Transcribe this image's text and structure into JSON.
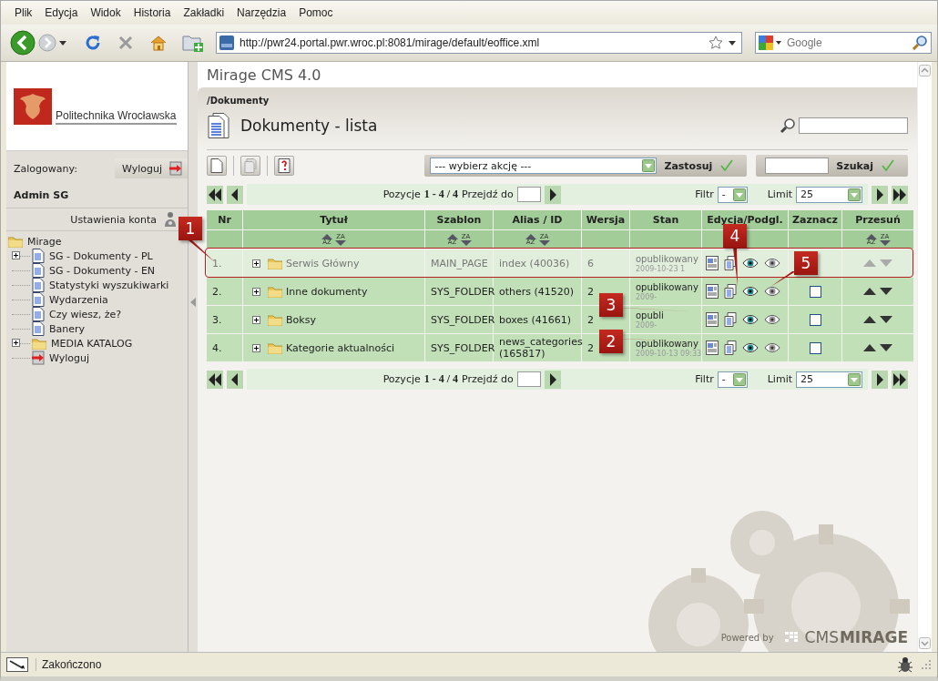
{
  "menu": [
    {
      "label": "Plik"
    },
    {
      "label": "Edycja"
    },
    {
      "label": "Widok"
    },
    {
      "label": "Historia"
    },
    {
      "label": "Zakładki"
    },
    {
      "label": "Narzędzia"
    },
    {
      "label": "Pomoc"
    }
  ],
  "nav": {
    "url": "http://pwr24.portal.pwr.wroc.pl:8081/mirage/default/eoffice.xml",
    "search_placeholder": "Google"
  },
  "app_title": "Mirage CMS 4.0",
  "sidebar": {
    "logo_text": "Politechnika Wrocławska",
    "logged_label": "Zalogowany:",
    "logout_button": "Wyloguj",
    "user": "Admin SG",
    "settings_link": "Ustawienia konta",
    "tree": [
      {
        "label": "Mirage",
        "kind": "folder",
        "expanded": true,
        "children": [
          {
            "label": "SG - Dokumenty - PL",
            "kind": "document",
            "expanded": false
          },
          {
            "label": "SG - Dokumenty - EN",
            "kind": "document"
          },
          {
            "label": "Statystyki wyszukiwarki",
            "kind": "document"
          },
          {
            "label": "Wydarzenia",
            "kind": "document"
          },
          {
            "label": "Czy wiesz, że?",
            "kind": "document"
          },
          {
            "label": "Banery",
            "kind": "document"
          },
          {
            "label": "MEDIA KATALOG",
            "kind": "folder",
            "expanded": false
          },
          {
            "label": "Wyloguj",
            "kind": "logout"
          }
        ]
      }
    ]
  },
  "breadcrumb": "/Dokumenty",
  "page_title": "Dokumenty - lista",
  "toolbar": {
    "action_select": "--- wybierz akcję ---",
    "apply_button": "Zastosuj",
    "search_button": "Szukaj"
  },
  "pagers": [
    {
      "label": "Pozycje",
      "range": "1 - 4 / 4",
      "goto_label": "Przejdź do",
      "filter_label": "Filtr",
      "filter_value": "-",
      "limit_label": "Limit",
      "limit_value": "25"
    },
    {
      "label": "Pozycje",
      "range": "1 - 4 / 4",
      "goto_label": "Przejdź do",
      "filter_label": "Filtr",
      "filter_value": "-",
      "limit_label": "Limit",
      "limit_value": "25"
    }
  ],
  "table": {
    "columns": [
      {
        "label": "Nr"
      },
      {
        "label": "Tytuł",
        "sort": [
          "AZ",
          "ZA"
        ]
      },
      {
        "label": "Szablon",
        "sort": [
          "AZ",
          "ZA"
        ]
      },
      {
        "label": "Alias / ID",
        "sort": [
          "AZ",
          "ZA"
        ]
      },
      {
        "label": "Wersja"
      },
      {
        "label": "Stan"
      },
      {
        "label": "Edycja/Podgl."
      },
      {
        "label": "Zaznacz"
      },
      {
        "label": "Przesuń",
        "sort": [
          "AZ",
          "ZA"
        ]
      }
    ],
    "rows": [
      {
        "nr": "1.",
        "title": "Serwis Główny",
        "expanded": false,
        "template": "MAIN_PAGE",
        "alias": "index (40036)",
        "version": "6",
        "status": "opublikowany",
        "date": "2009-10-23 1",
        "highlighted": true
      },
      {
        "nr": "2.",
        "title": "Inne dokumenty",
        "expanded": false,
        "template": "SYS_FOLDER",
        "alias": "others (41520)",
        "version": "2",
        "status": "opublikowany",
        "date": "2009-",
        "highlighted": false,
        "checked": false
      },
      {
        "nr": "3.",
        "title": "Boksy",
        "expanded": false,
        "template": "SYS_FOLDER",
        "alias": "boxes (41661)",
        "version": "2",
        "status": "opubli",
        "date": "2009-",
        "highlighted": false,
        "checked": false
      },
      {
        "nr": "4.",
        "title": "Kategorie aktualności",
        "expanded": false,
        "template": "SYS_FOLDER",
        "alias": "news_categories (165817)",
        "version": "2",
        "status": "opublikowany",
        "date": "2009-10-13 09:33",
        "highlighted": false,
        "checked": false
      }
    ]
  },
  "callouts": [
    {
      "label": "1"
    },
    {
      "label": "2"
    },
    {
      "label": "3"
    },
    {
      "label": "4"
    },
    {
      "label": "5"
    }
  ],
  "footer": {
    "powered_by": "Powered by",
    "brand_light": "CMS",
    "brand_bold": "MIRAGE"
  },
  "status_bar": "Zakończono"
}
